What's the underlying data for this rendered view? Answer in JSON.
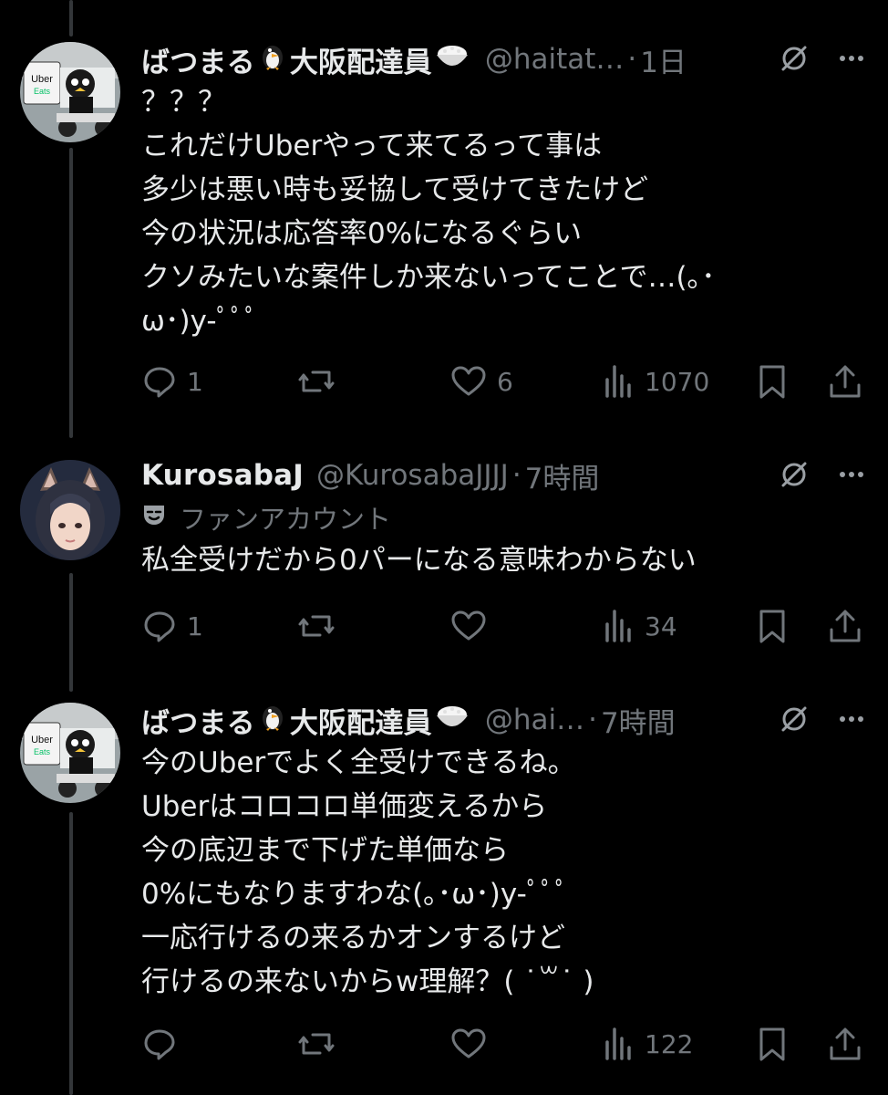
{
  "tweets": [
    {
      "name": "ばつまる",
      "name_suffix": "大阪配達員",
      "handle": "@haitat…",
      "separator": "·",
      "time": "1日",
      "body": "？？？\nこれだけUberやって来てるって事は\n多少は悪い時も妥協して受けてきたけど\n今の状況は応答率0%になるぐらい\nクソみたいな案件しか来ないってことで…(｡･\nω･)y-ﾟﾟﾟ",
      "counts": {
        "replies": "1",
        "reposts": "",
        "likes": "6",
        "views": "1070"
      },
      "avatar_text": {
        "brand_top": "Uber",
        "brand_bottom": "Eats"
      }
    },
    {
      "name": "KurosabaJ",
      "handle": "@KurosabaJJJJ",
      "separator": "·",
      "time": "7時間",
      "fan_label": "ファンアカウント",
      "body": "私全受けだから0パーになる意味わからない",
      "counts": {
        "replies": "1",
        "reposts": "",
        "likes": "",
        "views": "34"
      }
    },
    {
      "name": "ばつまる",
      "name_suffix": "大阪配達員",
      "handle": "@hai…",
      "separator": "·",
      "time": "7時間",
      "body": "今のUberでよく全受けできるね。\nUberはコロコロ単価変えるから\n今の底辺まで下げた単価なら\n0%にもなりますわな(｡･ω･)y-ﾟﾟﾟ\n一応行けるの来るかオンするけど\n行けるの来ないからw理解？( ˙꒳˙ )",
      "counts": {
        "replies": "",
        "reposts": "",
        "likes": "",
        "views": "122"
      },
      "avatar_text": {
        "brand_top": "Uber",
        "brand_bottom": "Eats"
      }
    }
  ],
  "icons": [
    "grok-icon",
    "more-icon",
    "reply-icon",
    "repost-icon",
    "like-icon",
    "views-icon",
    "bookmark-icon",
    "share-icon",
    "penguin-emoji-icon",
    "rice-bowl-emoji-icon",
    "mask-icon"
  ],
  "colors": {
    "background": "#000000",
    "text": "#e7e9ea",
    "muted": "#71767b",
    "thread_line": "#333639"
  }
}
